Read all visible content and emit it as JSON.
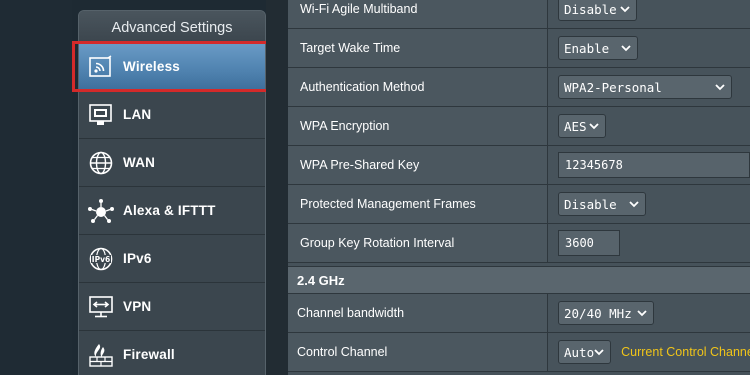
{
  "sidebar": {
    "header": "Advanced Settings",
    "items": [
      {
        "label": "Wireless",
        "icon": "wireless-icon",
        "active": true
      },
      {
        "label": "LAN",
        "icon": "lan-icon"
      },
      {
        "label": "WAN",
        "icon": "globe-icon"
      },
      {
        "label": "Alexa & IFTTT",
        "icon": "smart-home-icon"
      },
      {
        "label": "IPv6",
        "icon": "ipv6-globe-icon"
      },
      {
        "label": "VPN",
        "icon": "vpn-icon"
      },
      {
        "label": "Firewall",
        "icon": "firewall-icon"
      }
    ]
  },
  "settings": {
    "agile_multiband": {
      "label": "Wi-Fi Agile Multiband",
      "value": "Disable"
    },
    "target_wake_time": {
      "label": "Target Wake Time",
      "value": "Enable"
    },
    "auth_method": {
      "label": "Authentication Method",
      "value": "WPA2-Personal"
    },
    "wpa_encryption": {
      "label": "WPA Encryption",
      "value": "AES"
    },
    "wpa_psk": {
      "label": "WPA Pre-Shared Key",
      "value": "12345678"
    },
    "pmf": {
      "label": "Protected Management Frames",
      "value": "Disable"
    },
    "group_key_interval": {
      "label": "Group Key Rotation Interval",
      "value": "3600"
    }
  },
  "band_2g": {
    "title": "2.4 GHz",
    "channel_bandwidth": {
      "label": "Channel bandwidth",
      "value": "20/40 MHz"
    },
    "control_channel": {
      "label": "Control Channel",
      "value": "Auto",
      "hint": "Current Control Channe"
    }
  },
  "colors": {
    "active_item": "#4f82af",
    "highlight_border": "#d42a2a",
    "hint_text": "#f0c419"
  }
}
